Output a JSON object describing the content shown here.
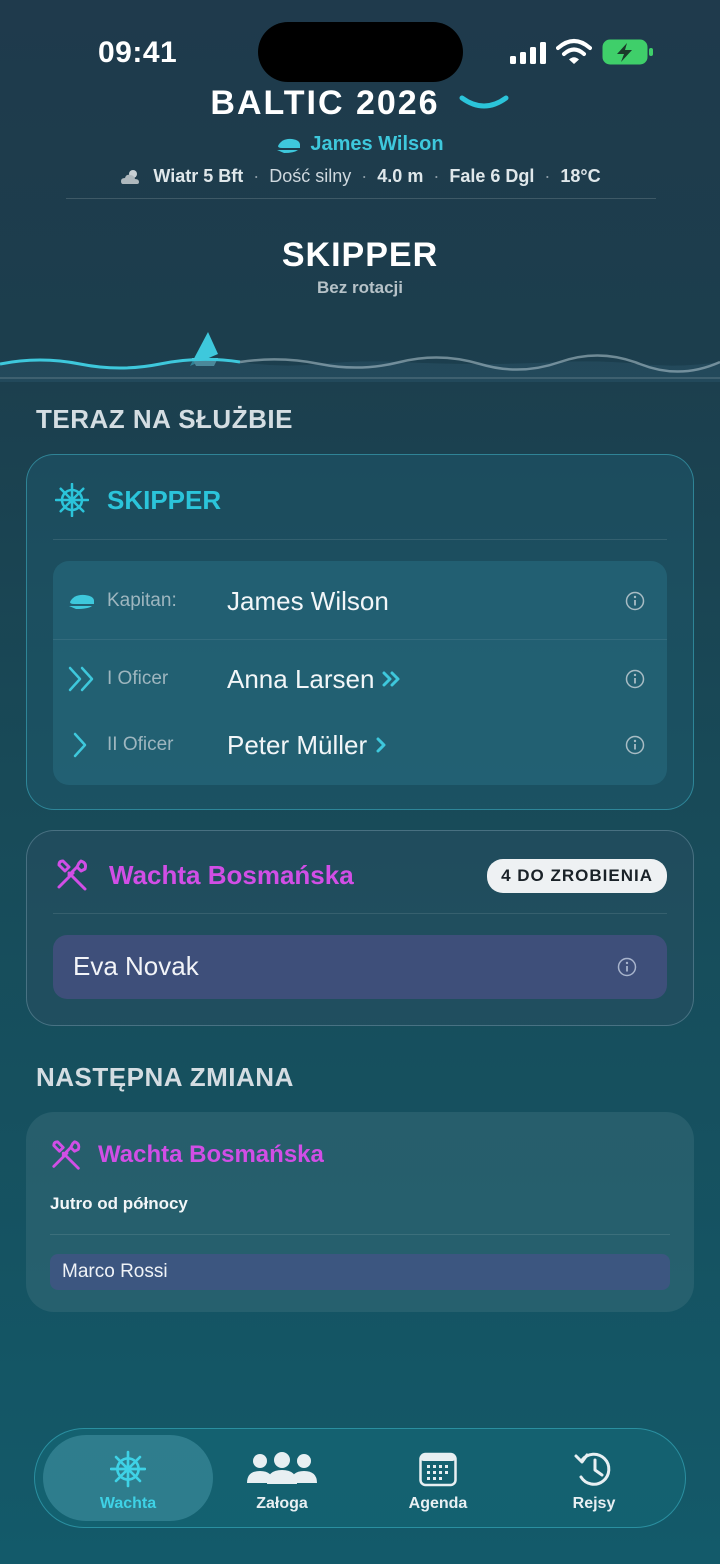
{
  "status": {
    "time": "09:41"
  },
  "header": {
    "trip": "BALTIC 2026",
    "captain": "James Wilson",
    "weather": {
      "wind": "Wiatr 5 Bft",
      "wind_desc": "Dość silny",
      "height": "4.0 m",
      "waves": "Fale 6 Dgl",
      "temp": "18°C"
    },
    "mode": "SKIPPER",
    "mode_sub": "Bez rotacji"
  },
  "on_duty": {
    "title": "TERAZ NA SŁUŻBIE",
    "skipper_card": {
      "label": "SKIPPER",
      "rows": [
        {
          "role": "Kapitan:",
          "name": "James Wilson",
          "icon": "captain-cap-icon"
        },
        {
          "role": "I Oficer",
          "name": "Anna Larsen",
          "icon": "double-chevron-icon"
        },
        {
          "role": "II Oficer",
          "name": "Peter Müller",
          "icon": "single-chevron-icon"
        }
      ]
    },
    "bosun_card": {
      "label": "Wachta Bosmańska",
      "badge": "4 DO ZROBIENIA",
      "member": "Eva Novak"
    }
  },
  "next": {
    "title": "NASTĘPNA ZMIANA",
    "label": "Wachta Bosmańska",
    "when": "Jutro od północy",
    "member": "Marco Rossi"
  },
  "tabs": [
    {
      "label": "Wachta",
      "icon": "helm-icon",
      "active": true
    },
    {
      "label": "Załoga",
      "icon": "crew-icon",
      "active": false
    },
    {
      "label": "Agenda",
      "icon": "calendar-icon",
      "active": false
    },
    {
      "label": "Rejsy",
      "icon": "history-icon",
      "active": false
    }
  ],
  "colors": {
    "accent": "#2bc4da",
    "bosun": "#d14ee6"
  }
}
